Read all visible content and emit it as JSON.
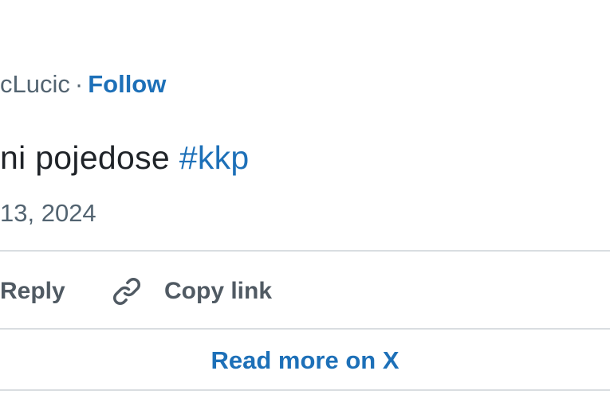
{
  "header": {
    "handle": "cLucic",
    "separator": "·",
    "follow_label": "Follow"
  },
  "tweet": {
    "text": "ni pojedose ",
    "hashtag": "#kkp",
    "date": "13, 2024"
  },
  "actions": {
    "reply_label": "Reply",
    "copy_link_label": "Copy link",
    "copy_link_icon": "link-icon"
  },
  "footer": {
    "read_more_label": "Read more on X"
  },
  "colors": {
    "link_blue": "#1d70b8",
    "muted_text": "#536471",
    "divider": "#d9dde1"
  }
}
